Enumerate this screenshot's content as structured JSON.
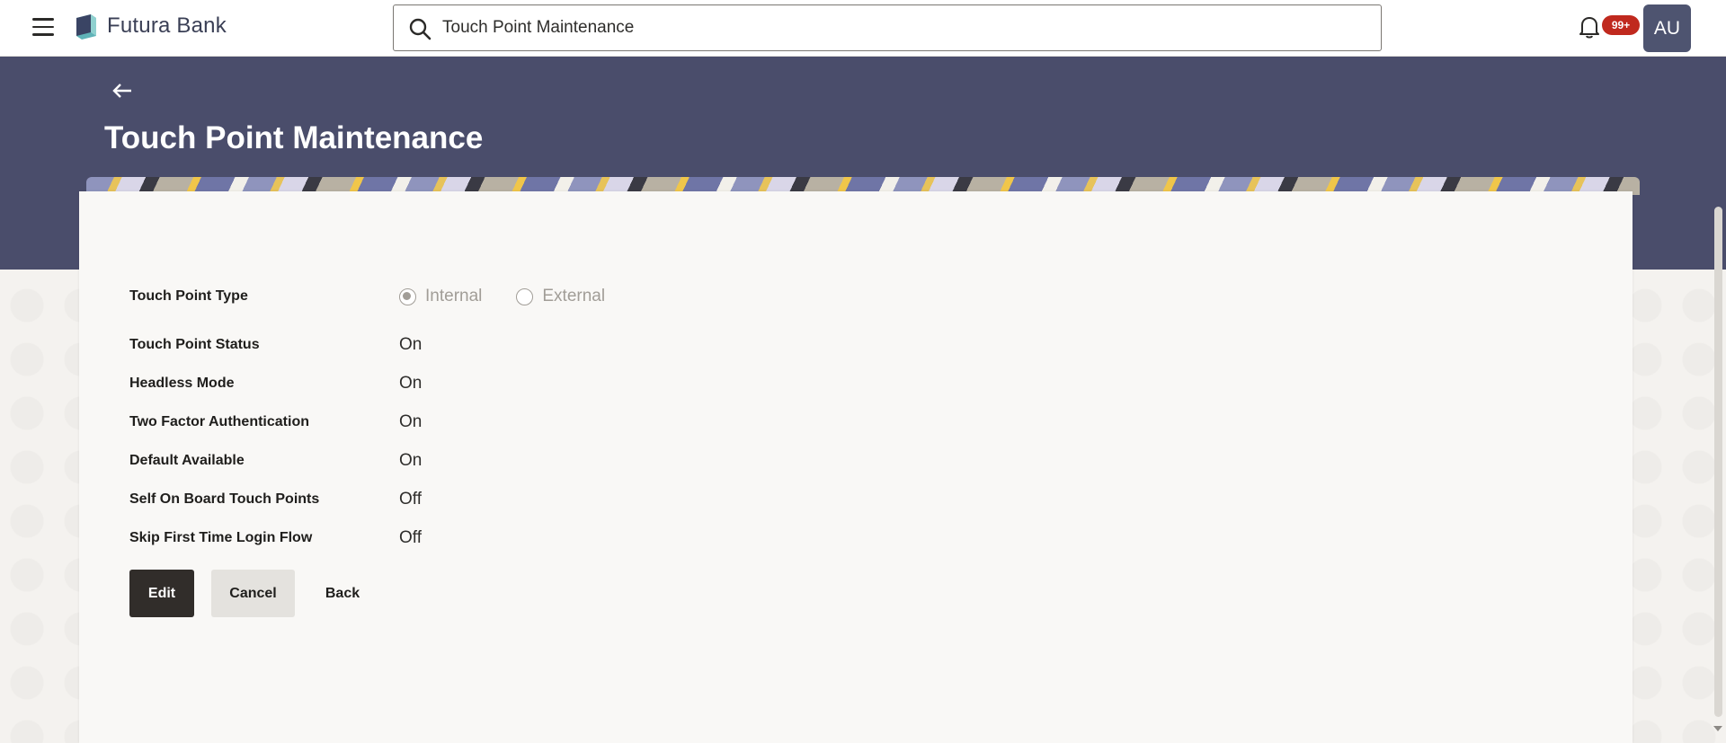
{
  "app": {
    "brand_name": "Futura Bank",
    "menu_icon": "hamburger-menu-icon",
    "logo_icon": "bank-logo-icon"
  },
  "search": {
    "value": "Touch Point Maintenance",
    "icon": "search-icon"
  },
  "notifications": {
    "badge": "99+",
    "icon": "bell-icon"
  },
  "user": {
    "initials": "AU"
  },
  "header": {
    "title": "Touch Point Maintenance",
    "back_icon": "back-arrow-icon"
  },
  "form": {
    "touch_point_type": {
      "label": "Touch Point Type",
      "options": [
        {
          "label": "Internal",
          "checked": true
        },
        {
          "label": "External",
          "checked": false
        }
      ]
    },
    "fields": [
      {
        "label": "Touch Point Status",
        "value": "On"
      },
      {
        "label": "Headless Mode",
        "value": "On"
      },
      {
        "label": "Two Factor Authentication",
        "value": "On"
      },
      {
        "label": "Default Available",
        "value": "On"
      },
      {
        "label": "Self On Board Touch Points",
        "value": "Off"
      },
      {
        "label": "Skip First Time Login Flow",
        "value": "Off"
      }
    ]
  },
  "actions": {
    "edit_label": "Edit",
    "cancel_label": "Cancel",
    "back_label": "Back"
  },
  "colors": {
    "header_band": "#4a4d6b",
    "primary_button": "#312d2a",
    "badge": "#c0291e",
    "avatar": "#4e5470"
  }
}
